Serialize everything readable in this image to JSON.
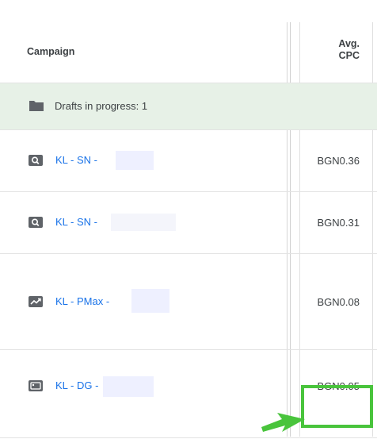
{
  "header": {
    "campaign_label": "Campaign",
    "cpc_label_line1": "Avg.",
    "cpc_label_line2": "CPC"
  },
  "drafts": {
    "label": "Drafts in progress: 1",
    "icon": "folder-icon"
  },
  "rows": [
    {
      "icon": "search-icon",
      "name": "KL - SN -",
      "cpc": "BGN0.36"
    },
    {
      "icon": "search-icon",
      "name": "KL - SN -",
      "cpc": "BGN0.31"
    },
    {
      "icon": "performance-max-icon",
      "name": "KL - PMax -",
      "cpc": "BGN0.08"
    },
    {
      "icon": "display-icon",
      "name": "KL - DG -",
      "cpc": "BGN0.05"
    }
  ],
  "colors": {
    "link": "#1a73e8",
    "drafts_bg": "#e7f1e7",
    "highlight": "#49c43c"
  }
}
